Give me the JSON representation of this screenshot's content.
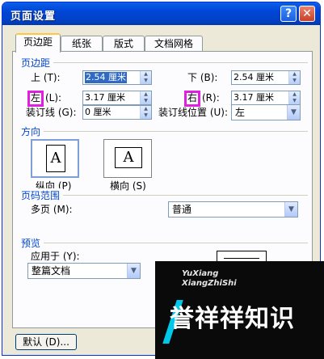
{
  "window": {
    "title": "页面设置",
    "help_label": "?",
    "close_label": "✕"
  },
  "tabs": [
    {
      "label": "页边距"
    },
    {
      "label": "纸张"
    },
    {
      "label": "版式"
    },
    {
      "label": "文档网格"
    }
  ],
  "margins": {
    "group_label": "页边距",
    "top_label": "上 (T):",
    "top_value": "2.54 厘米",
    "bottom_label": "下 (B):",
    "bottom_value": "2.54 厘米",
    "left_label_char": "左",
    "left_label_rest": "(L):",
    "left_value": "3.17 厘米",
    "right_label_char": "右",
    "right_label_rest": "(R):",
    "right_value": "3.17 厘米",
    "gutter_label": "装订线 (G):",
    "gutter_value": "0 厘米",
    "gutter_pos_label": "装订线位置 (U):",
    "gutter_pos_value": "左"
  },
  "orientation": {
    "group_label": "方向",
    "portrait_label": "纵向 (P)",
    "landscape_label": "横向 (S)",
    "icon_letter": "A"
  },
  "pages": {
    "group_label": "页码范围",
    "multi_label": "多页 (M):",
    "multi_value": "普通"
  },
  "preview": {
    "group_label": "预览",
    "apply_label": "应用于 (Y):",
    "apply_value": "整篇文档"
  },
  "buttons": {
    "default_label": "默认 (D)..."
  },
  "watermark": {
    "line1": "YuXiang",
    "line2": "XiangZhiShi",
    "text": "誉祥祥知识"
  },
  "icons": {
    "spin": "up-down-arrows",
    "dropdown": "chevron-down"
  }
}
